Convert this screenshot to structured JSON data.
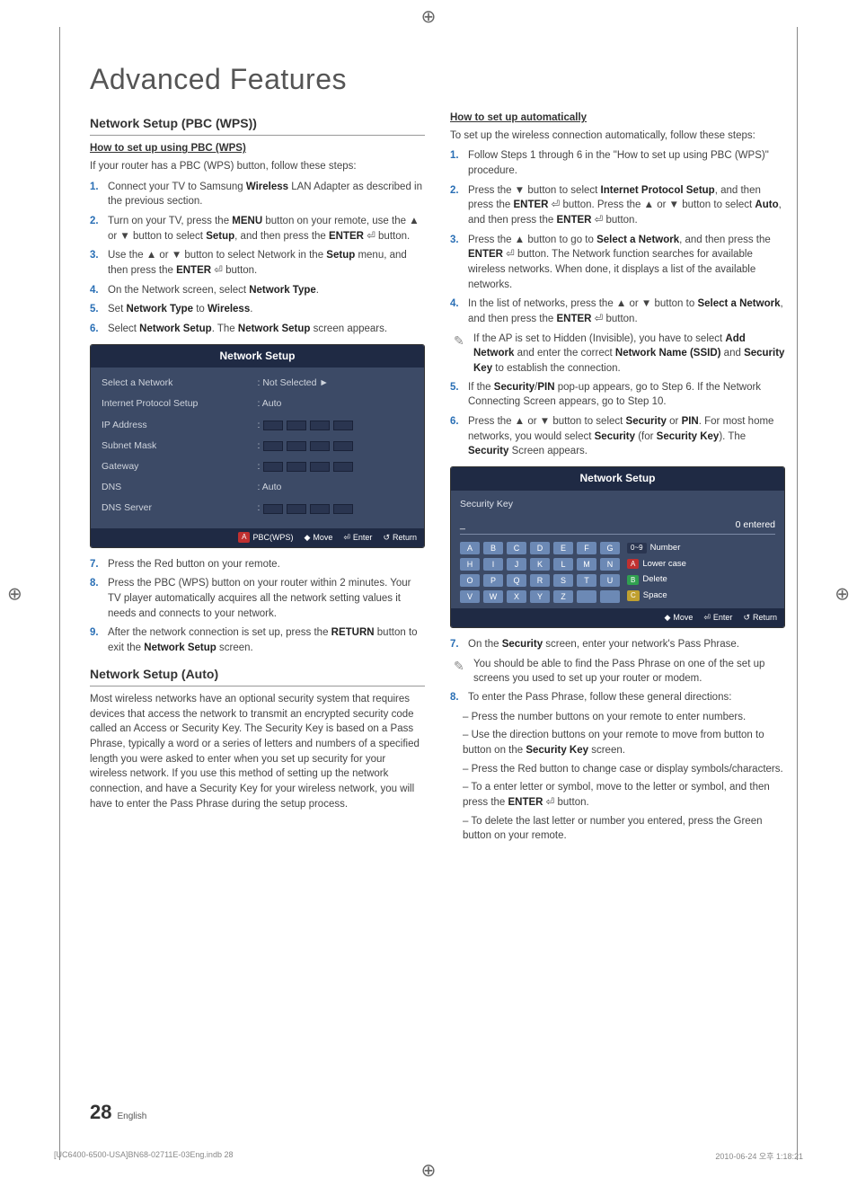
{
  "title": "Advanced Features",
  "left": {
    "section1": "Network Setup (PBC (WPS))",
    "sub1": "How to set up using PBC (WPS)",
    "intro": "If your router has a PBC (WPS) button, follow these steps:",
    "steps": [
      "Connect your TV to Samsung Wireless LAN Adapter as described in the previous section.",
      "Turn on your TV, press the MENU button on your remote, use the ▲ or ▼ button to select Setup, and then press the ENTER ⏎ button.",
      "Use the ▲ or ▼ button to select Network in the Setup menu, and then press the ENTER ⏎ button.",
      "On the Network screen, select Network Type.",
      "Set Network Type to Wireless.",
      "Select Network Setup. The Network Setup screen appears."
    ],
    "panel": {
      "title": "Network Setup",
      "rows": [
        {
          "label": "Select a Network",
          "value": ": Not Selected  ►"
        },
        {
          "label": "Internet Protocol Setup",
          "value": ": Auto"
        },
        {
          "label": "IP Address",
          "value": "octets"
        },
        {
          "label": "Subnet Mask",
          "value": "octets"
        },
        {
          "label": "Gateway",
          "value": "octets"
        },
        {
          "label": "DNS",
          "value": ": Auto"
        },
        {
          "label": "DNS Server",
          "value": "octets"
        }
      ],
      "footer": {
        "a": "PBC(WPS)",
        "move": "Move",
        "enter": "Enter",
        "return": "Return"
      }
    },
    "steps2": [
      "Press the Red button on your remote.",
      "Press the PBC (WPS) button on your router within 2 minutes. Your TV player automatically acquires all the network setting values it needs and connects to your network.",
      "After the network connection is set up, press the RETURN button to exit the Network Setup screen."
    ],
    "section2": "Network Setup (Auto)",
    "autopara": "Most wireless networks have an optional security system that requires devices that access the network to transmit an encrypted security code called an Access or Security Key. The Security Key is based on a Pass Phrase, typically a word or a series of letters and numbers of a specified length you were asked to enter when you set up security for your wireless network.  If you use this method of setting up the network connection, and have a Security Key for your wireless network, you will have to enter the Pass Phrase during the setup process."
  },
  "right": {
    "sub1": "How to set up automatically",
    "intro": "To set up the wireless connection automatically, follow these steps:",
    "steps": [
      "Follow Steps 1 through 6 in the \"How to set up using PBC (WPS)\" procedure.",
      "Press the ▼ button to select Internet Protocol Setup, and then press the ENTER ⏎ button. Press the ▲ or ▼ button to select Auto, and then press the ENTER ⏎ button.",
      "Press the ▲ button to go to Select a Network, and then press the ENTER ⏎ button. The Network function searches for available wireless networks. When done, it displays a list of the available networks.",
      "In the list of networks, press the ▲ or ▼ button to Select a Network, and then press the ENTER ⏎ button."
    ],
    "note1": "If the AP is set to Hidden (Invisible), you have to select Add Network and enter the correct Network Name (SSID) and Security Key to establish the connection.",
    "steps2": [
      "If the Security/PIN pop-up appears, go to Step 6. If the Network Connecting Screen appears, go to Step 10.",
      "Press the ▲ or ▼ button to select Security or PIN. For most home networks, you would select Security (for Security Key). The Security Screen appears."
    ],
    "panel": {
      "title": "Network Setup",
      "sec": "Security Key",
      "entered": "0 entered",
      "letters": [
        "A",
        "B",
        "C",
        "D",
        "E",
        "F",
        "G",
        "H",
        "I",
        "J",
        "K",
        "L",
        "M",
        "N",
        "O",
        "P",
        "Q",
        "R",
        "S",
        "T",
        "U",
        "V",
        "W",
        "X",
        "Y",
        "Z",
        " ",
        " "
      ],
      "side": [
        {
          "badge": "0~9",
          "cls": "num",
          "label": "Number"
        },
        {
          "badge": "A",
          "cls": "a",
          "label": "Lower case"
        },
        {
          "badge": "B",
          "cls": "b",
          "label": "Delete"
        },
        {
          "badge": "C",
          "cls": "c",
          "label": "Space"
        }
      ],
      "footer": {
        "move": "Move",
        "enter": "Enter",
        "return": "Return"
      }
    },
    "steps3": [
      "On the Security screen, enter your network's Pass Phrase."
    ],
    "note2": "You should be able to find the Pass Phrase on one of the set up screens you used to set up your router or modem.",
    "steps4": [
      "To enter the Pass Phrase, follow these general directions:"
    ],
    "dashes": [
      "Press the number buttons on your remote to enter numbers.",
      "Use the direction buttons on your remote to move from button to button on the Security Key screen.",
      "Press the Red button to change case or display symbols/characters.",
      "To a enter letter or symbol, move to the letter or symbol, and then press the ENTER ⏎ button.",
      "To delete the last letter or number you entered, press the Green button on your remote."
    ]
  },
  "page": {
    "num": "28",
    "lang": "English"
  },
  "footer": {
    "file": "[UC6400-6500-USA]BN68-02711E-03Eng.indb   28",
    "ts": "2010-06-24   오후 1:18:21"
  }
}
